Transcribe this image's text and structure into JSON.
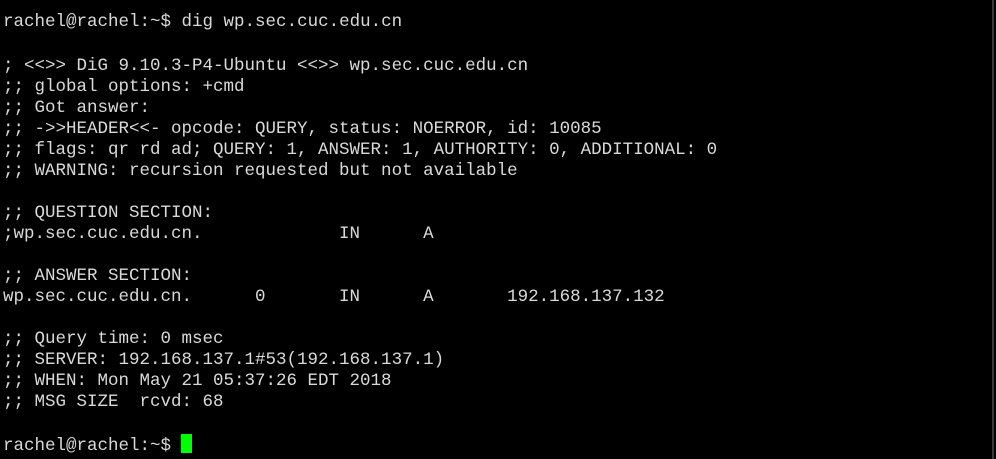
{
  "terminal": {
    "prompt": "rachel@rachel:~$",
    "command": "dig wp.sec.cuc.edu.cn",
    "output": [
      "; <<>> DiG 9.10.3-P4-Ubuntu <<>> wp.sec.cuc.edu.cn",
      ";; global options: +cmd",
      ";; Got answer:",
      ";; ->>HEADER<<- opcode: QUERY, status: NOERROR, id: 10085",
      ";; flags: qr rd ad; QUERY: 1, ANSWER: 1, AUTHORITY: 0, ADDITIONAL: 0",
      ";; WARNING: recursion requested but not available",
      ";; QUESTION SECTION:",
      ";wp.sec.cuc.edu.cn.             IN      A",
      ";; ANSWER SECTION:",
      "wp.sec.cuc.edu.cn.      0       IN      A       192.168.137.132",
      ";; Query time: 0 msec",
      ";; SERVER: 192.168.137.1#53(192.168.137.1)",
      ";; WHEN: Mon May 21 05:37:26 EDT 2018",
      ";; MSG SIZE  rcvd: 68"
    ]
  },
  "colors": {
    "background": "#000000",
    "text": "#d9d9d9",
    "cursor": "#00ff00"
  }
}
